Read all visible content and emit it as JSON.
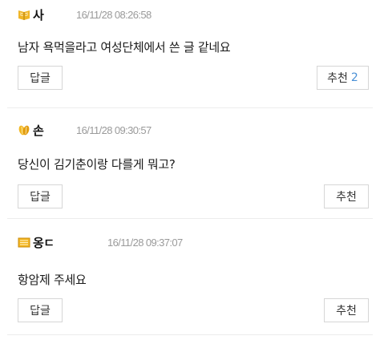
{
  "comments": [
    {
      "level_icon": "book-badge-icon",
      "nickname": "사",
      "date": "16/11/28 08:26:58",
      "text": "남자 욕먹을라고 여성단체에서 쓴 글 같네요",
      "reply_label": "답글",
      "like_label": "추천",
      "like_count": "2"
    },
    {
      "level_icon": "gold-leaf-badge-icon",
      "nickname": "손",
      "date": "16/11/28 09:30:57",
      "text": "당신이 김기춘이랑 다를게 뭐고?",
      "reply_label": "답글",
      "like_label": "추천",
      "like_count": ""
    },
    {
      "level_icon": "notebook-badge-icon",
      "nickname": "옹ㄷ",
      "date": "16/11/28 09:37:07",
      "text": "항암제 주세요",
      "reply_label": "답글",
      "like_label": "추천",
      "like_count": ""
    }
  ],
  "colors": {
    "like_count": "#4a90d6",
    "date": "#9a9a9a",
    "border": "#d6d6d6",
    "icon_gold": "#e8b020"
  }
}
